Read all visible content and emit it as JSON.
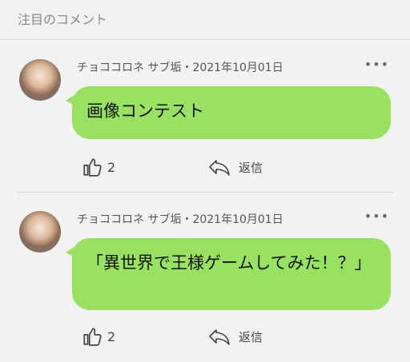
{
  "section": {
    "title": "注目のコメント"
  },
  "comments": [
    {
      "meta": "チョココロネ サブ垢・2021年10月01日",
      "text": "画像コンテスト",
      "likes": "2",
      "reply_label": "返信"
    },
    {
      "meta": "チョココロネ サブ垢・2021年10月01日",
      "text": "「異世界で王様ゲームしてみた！？」",
      "likes": "2",
      "reply_label": "返信"
    }
  ],
  "icons": {
    "more": "more-horizontal-icon",
    "like": "thumbs-up-icon",
    "reply": "reply-icon",
    "avatar": "avatar-image"
  },
  "colors": {
    "bubble": "#99e25f",
    "background": "#f2f2f2",
    "text_secondary": "#555555"
  }
}
